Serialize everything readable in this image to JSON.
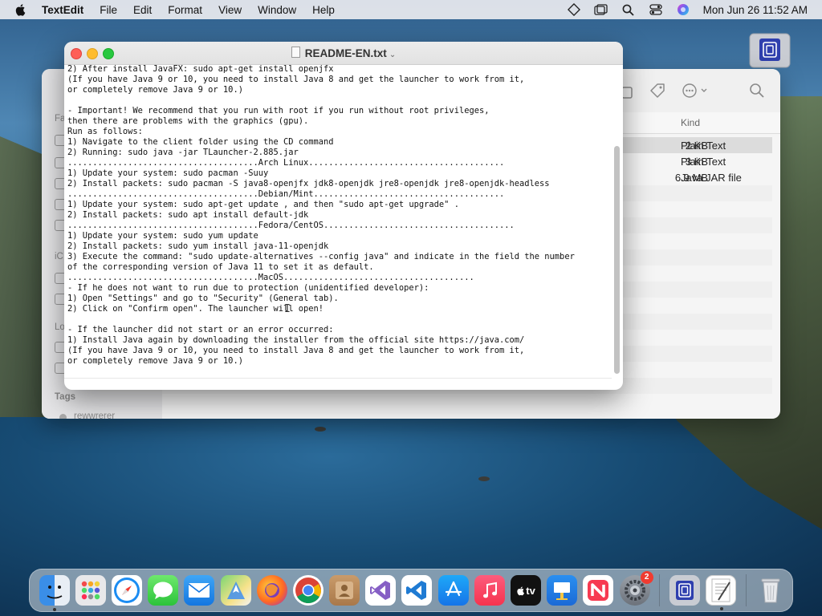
{
  "menubar": {
    "app_name": "TextEdit",
    "items": [
      "File",
      "Edit",
      "Format",
      "View",
      "Window",
      "Help"
    ],
    "clock": "Mon Jun 26  11:52 AM"
  },
  "textedit": {
    "title": "README-EN.txt",
    "content": "2) After install JavaFX: sudo apt-get install openjfx\n(If you have Java 9 or 10, you need to install Java 8 and get the launcher to work from it,\nor completely remove Java 9 or 10.)\n\n- Important! We recommend that you run with root if you run without root privileges,\nthen there are problems with the graphics (gpu).\nRun as follows:\n1) Navigate to the client folder using the CD command\n2) Running: sudo java -jar TLauncher-2.885.jar\n......................................Arch Linux.......................................\n1) Update your system: sudo pacman -Suuy\n2) Install packets: sudo pacman -S java8-openjfx jdk8-openjdk jre8-openjdk jre8-openjdk-headless\n......................................Debian/Mint......................................\n1) Update your system: sudo apt-get update , and then \"sudo apt-get upgrade\" .\n2) Install packets: sudo apt install default-jdk\n......................................Fedora/CentOS......................................\n1) Update your system: sudo yum update\n2) Install packets: sudo yum install java-11-openjdk\n3) Execute the command: \"sudo update-alternatives --config java\" and indicate in the field the number\nof the corresponding version of Java 11 to set it as default.\n......................................MacOS......................................\n- If he does not want to run due to protection (unidentified developer):\n1) Open \"Settings\" and go to \"Security\" (General tab).\n2) Click on \"Confirm open\". The launcher will open!\n\n- If the launcher did not start or an error occurred:\n1) Install Java again by downloading the installer from the official site https://java.com/\n(If you have Java 9 or 10, you need to install Java 8 and get the launcher to work from it,\nor completely remove Java 9 or 10.)"
  },
  "finder": {
    "column_kind": "Kind",
    "files": [
      {
        "size": "2 KB",
        "kind": "Plain Text"
      },
      {
        "size": "3 KB",
        "kind": "Plain Text"
      },
      {
        "size": "6.9 MB",
        "kind": "Java JAR file"
      }
    ],
    "sidebar_labels": [
      "Fa",
      "iC",
      "Lo"
    ],
    "tags_heading": "Tags",
    "tag_item": "rewwrerer"
  },
  "dock": {
    "apps": [
      "finder",
      "launchpad",
      "safari",
      "messages",
      "mail",
      "maps",
      "firefox",
      "chrome",
      "contacts",
      "visual-studio",
      "vscode",
      "app-store",
      "music",
      "apple-tv",
      "keynote",
      "news",
      "system-preferences"
    ],
    "apple_tv_label": "tv",
    "system_preferences_badge": "2",
    "extra": [
      "disk-utility",
      "textedit",
      "trash"
    ]
  },
  "colors": {
    "close": "#fe5f57",
    "minimize": "#febc2e",
    "maximize": "#28c840",
    "badge": "#f03b30"
  }
}
